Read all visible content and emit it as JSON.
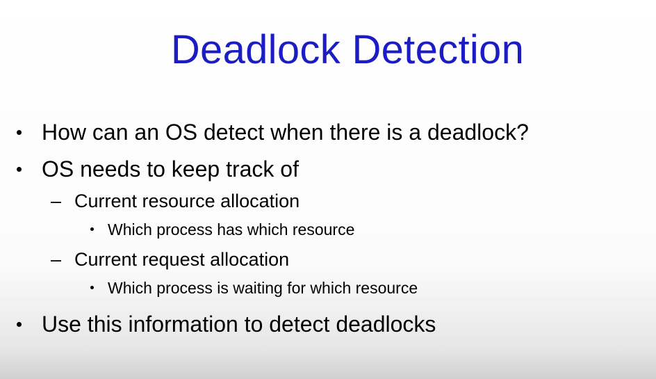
{
  "slide": {
    "title": "Deadlock Detection",
    "items": [
      {
        "level": 1,
        "bullet": "•",
        "text": "How can an OS detect when there is a deadlock?"
      },
      {
        "level": 1,
        "bullet": "•",
        "text": "OS needs to keep track of"
      },
      {
        "level": 2,
        "bullet": "–",
        "text": "Current resource allocation"
      },
      {
        "level": 3,
        "bullet": "•",
        "text": "Which process has which resource"
      },
      {
        "level": 2,
        "bullet": "–",
        "text": "Current request allocation"
      },
      {
        "level": 3,
        "bullet": "•",
        "text": "Which process is waiting for which resource"
      },
      {
        "level": 1,
        "bullet": "•",
        "text": "Use this information to detect deadlocks"
      }
    ]
  },
  "colors": {
    "title": "#1c1cc4",
    "text": "#000000"
  }
}
